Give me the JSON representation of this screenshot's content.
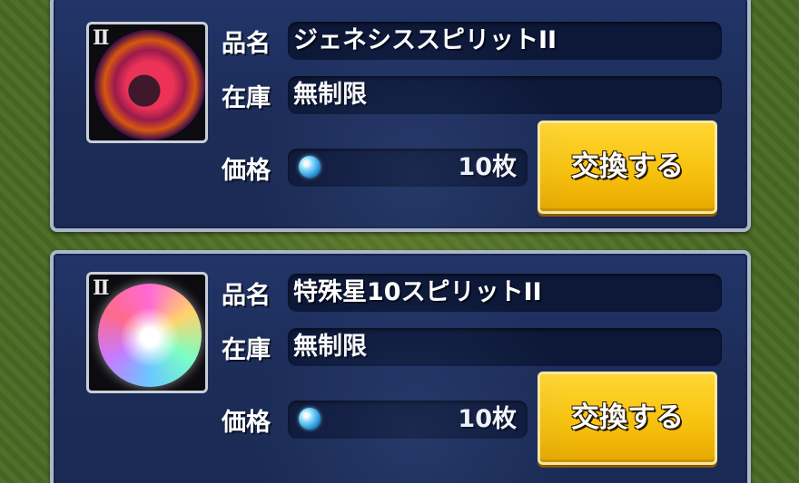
{
  "labels": {
    "name": "品名",
    "stock": "在庫",
    "price": "価格"
  },
  "items": [
    {
      "rank": "Ⅱ",
      "name": "ジェネシススピリットII",
      "stock": "無制限",
      "price": "10枚",
      "button": "交換する"
    },
    {
      "rank": "Ⅱ",
      "name": "特殊星10スピリットII",
      "stock": "無制限",
      "price": "10枚",
      "button": "交換する"
    }
  ],
  "colors": {
    "card_bg": "#1c2c58",
    "card_border": "#aab6cc",
    "button": "#f7c20e",
    "field_bg": "#0d1838"
  },
  "icons": {
    "currency": "gem-icon"
  }
}
